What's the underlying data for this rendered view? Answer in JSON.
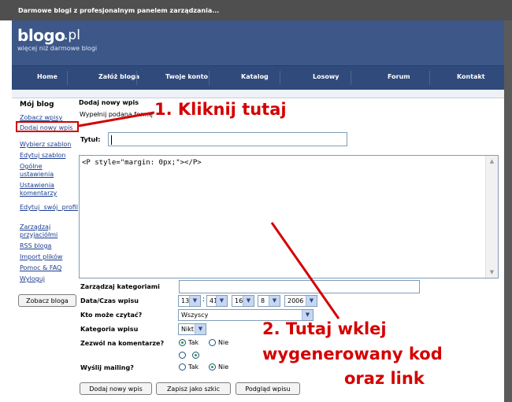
{
  "browser": {
    "title": "Darmowe blogi z profesjonalnym panelem zarządzania..."
  },
  "header": {
    "logo": "blogo",
    "logo_tld": ".pl",
    "tagline": "więcej niż darmowe blogi"
  },
  "nav": {
    "items": [
      "Home",
      "Załóż bloga",
      "Twoje konto",
      "Katalog",
      "Losowy",
      "Forum",
      "Kontakt"
    ]
  },
  "sidebar": {
    "title": "Mój blog",
    "items": [
      "Zobacz wpisy",
      "Dodaj nowy wpis",
      "Wybierz szablon",
      "Edytuj szablon",
      "Ogólne ustawienia",
      "Ustawienia komentarzy",
      "Edytuj swój profil",
      "Zarządzaj przyjaciółmi",
      "RSS bloga",
      "Import plików",
      "Pomoc & FAQ",
      "Wyloguj"
    ],
    "view_button": "Zobacz bloga"
  },
  "form": {
    "heading": "Dodaj nowy wpis",
    "instruction": "Wypełnij podaną formę",
    "title_label": "Tytuł:",
    "title_value": "",
    "content": "<P style=\"margin: 0px;\"></P>",
    "categories_label": "Zarządzaj kategoriami",
    "categories_value": "",
    "datetime_label": "Data/Czas wpisu",
    "datetime": {
      "day": "13",
      "hour": "41",
      "minute": "16",
      "month": "8",
      "year": "2006"
    },
    "readers_label": "Kto może czytać?",
    "readers_value": "Wszyscy",
    "category_label": "Kategoria wpisu",
    "category_value": "Nikt",
    "comments_label": "Zezwól na komentarze?",
    "comments_yes": "Tak",
    "comments_no": "Nie",
    "mailing_label": "Wyślij mailing?",
    "mailing_yes": "Tak",
    "mailing_no": "Nie",
    "buttons": {
      "add": "Dodaj nowy wpis",
      "draft": "Zapisz jako szkic",
      "preview": "Podgląd wpisu"
    }
  },
  "annotations": {
    "step1": "1. Kliknij tutaj",
    "step2_line1": "2. Tutaj wklej",
    "step2_line2": "wygenerowany kod",
    "step2_line3": "oraz link",
    "color": "#d40000"
  },
  "colors": {
    "header": "#3c5788",
    "nav": "#2f4a7b",
    "link": "#1a3d8f",
    "titlebar": "#4f4f4f"
  }
}
